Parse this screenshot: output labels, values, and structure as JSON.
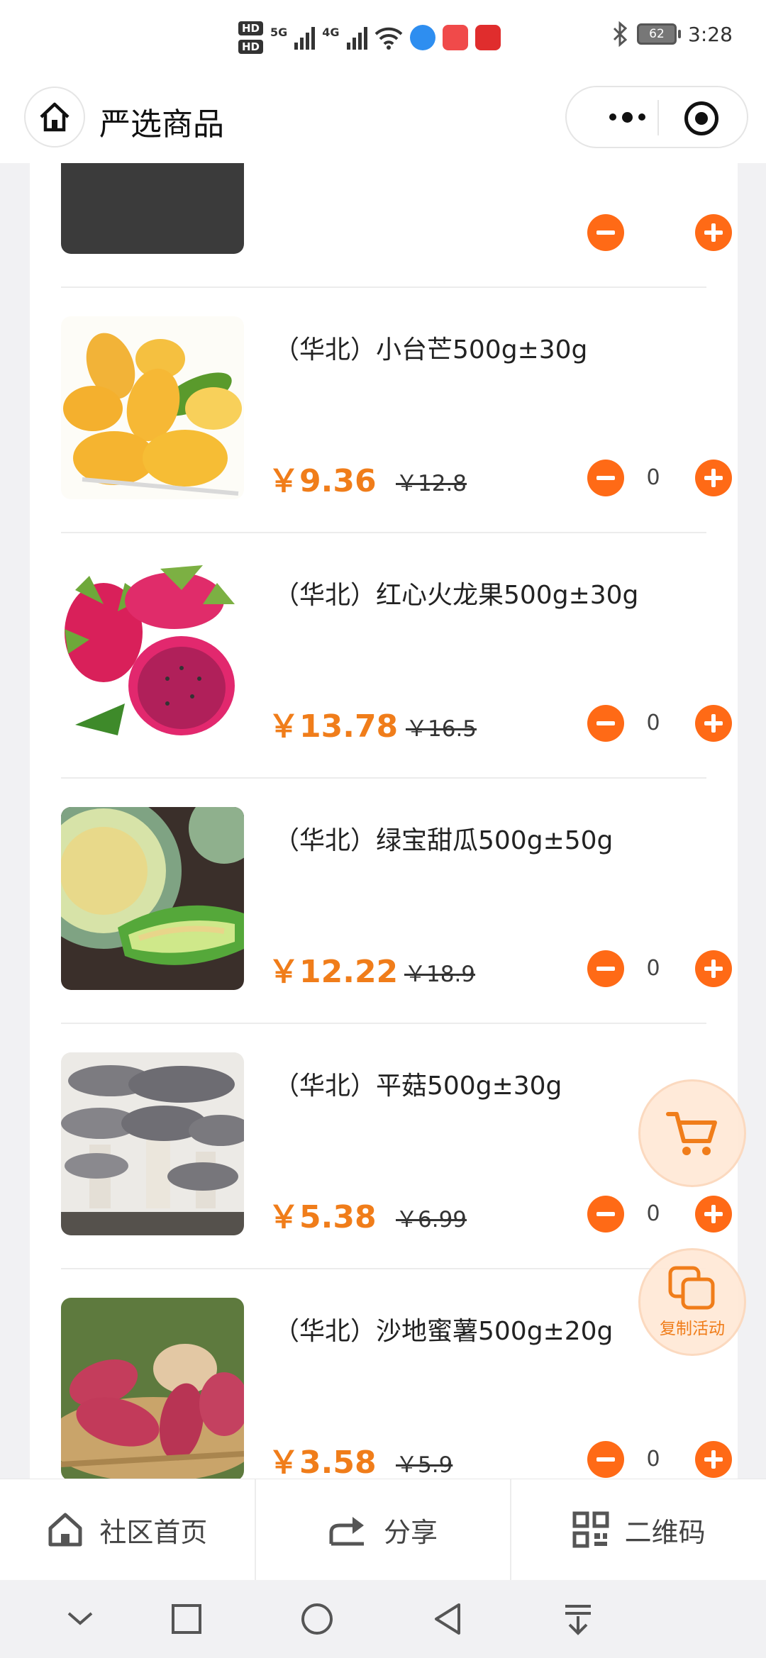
{
  "status_bar": {
    "hd1": "HD",
    "hd2": "HD",
    "net1": "5G",
    "net2": "4G",
    "battery": "62",
    "time": "3:28"
  },
  "nav": {
    "title": "严选商品"
  },
  "products": [
    {
      "name": "（华北）小台芒500g±30g",
      "price": "￥9.36",
      "original_price": "￥12.8",
      "quantity": "0"
    },
    {
      "name": "（华北）红心火龙果500g±30g",
      "price": "￥13.78",
      "original_price": "￥16.5",
      "quantity": "0"
    },
    {
      "name": "（华北）绿宝甜瓜500g±50g",
      "price": "￥12.22",
      "original_price": "￥18.9",
      "quantity": "0"
    },
    {
      "name": "（华北）平菇500g±30g",
      "price": "￥5.38",
      "original_price": "￥6.99",
      "quantity": "0"
    },
    {
      "name": "（华北）沙地蜜薯500g±20g",
      "price": "￥3.58",
      "original_price": "￥5.9",
      "quantity": "0"
    }
  ],
  "float": {
    "copy_label": "复制活动"
  },
  "tabbar": {
    "home": "社区首页",
    "share": "分享",
    "qrcode": "二维码"
  },
  "colors": {
    "accent": "#ff6a16",
    "price": "#f07d1a"
  },
  "icons": {
    "home": "home-icon",
    "more": "more-dots-icon",
    "close": "target-icon",
    "cart": "cart-icon",
    "copy": "copy-icon",
    "share": "share-icon",
    "qr": "qr-icon"
  }
}
